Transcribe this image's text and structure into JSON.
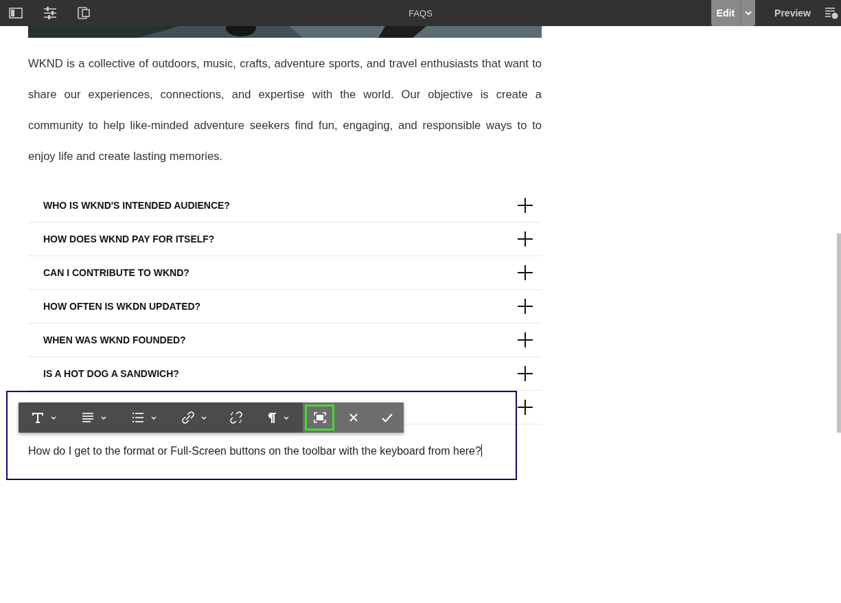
{
  "top_bar": {
    "title": "FAQS",
    "modes": [
      {
        "label": "Edit",
        "selected": true,
        "has_menu": true
      },
      {
        "label": "Preview",
        "selected": false,
        "has_menu": false
      }
    ]
  },
  "intro": "WKND is a collective of outdoors, music, crafts, adventure sports, and travel enthusiasts that want to share our experiences, connections, and expertise with the world. Our objective is create a community to help like-minded adventure seekers find fun, engaging, and responsible ways to to enjoy life and create lasting memories.",
  "faqs": [
    {
      "question": "WHO IS WKND'S INTENDED AUDIENCE?",
      "expanded": false
    },
    {
      "question": "HOW DOES WKND PAY FOR ITSELF?",
      "expanded": false
    },
    {
      "question": "CAN I CONTRIBUTE TO WKND?",
      "expanded": false
    },
    {
      "question": "HOW OFTEN IS WKDN UPDATED?",
      "expanded": false
    },
    {
      "question": "WHEN WAS WKND FOUNDED?",
      "expanded": false
    },
    {
      "question": "IS A HOT DOG A SANDWICH?",
      "expanded": false
    },
    {
      "expanded": false
    }
  ],
  "editor": {
    "toolbar": [
      {
        "has_menu": true,
        "selected": false
      },
      {
        "has_menu": true,
        "selected": false
      },
      {
        "has_menu": true,
        "selected": false
      },
      {
        "has_menu": true,
        "selected": false
      },
      {
        "has_menu": false,
        "selected": false
      },
      {
        "has_menu": true,
        "selected": false
      },
      {
        "has_menu": false,
        "selected": true
      },
      {
        "has_menu": false,
        "selected": false
      },
      {
        "has_menu": false,
        "selected": false
      }
    ],
    "text": "How do I get to the format or Full-Screen buttons on the toolbar with the keyboard from here?"
  }
}
